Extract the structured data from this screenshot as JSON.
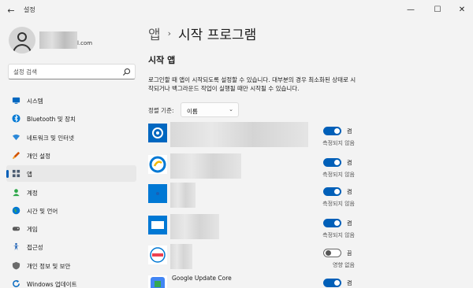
{
  "window": {
    "title": "설정",
    "back_glyph": "←",
    "minimize_glyph": "—",
    "maximize_glyph": "☐",
    "close_glyph": "✕"
  },
  "user": {
    "email_suffix": "l.com"
  },
  "search": {
    "placeholder": "설정 검색"
  },
  "nav": {
    "items": [
      {
        "label": "시스템",
        "icon": "monitor-icon",
        "color": "#0067c0"
      },
      {
        "label": "Bluetooth 및 장치",
        "icon": "bluetooth-icon",
        "color": "#0078d4"
      },
      {
        "label": "네트워크 및 인터넷",
        "icon": "network-icon",
        "color": "#2b88d8"
      },
      {
        "label": "개인 설정",
        "icon": "brush-icon",
        "color": "#d35400"
      },
      {
        "label": "앱",
        "icon": "apps-icon",
        "color": "#4a5a70",
        "active": true
      },
      {
        "label": "계정",
        "icon": "account-icon",
        "color": "#2ea84a"
      },
      {
        "label": "시간 및 언어",
        "icon": "globe-icon",
        "color": "#0078d4"
      },
      {
        "label": "게임",
        "icon": "game-icon",
        "color": "#5a5a5a"
      },
      {
        "label": "접근성",
        "icon": "accessibility-icon",
        "color": "#1a5fb4"
      },
      {
        "label": "개인 정보 및 보안",
        "icon": "shield-icon",
        "color": "#6b6b6b"
      },
      {
        "label": "Windows 업데이트",
        "icon": "update-icon",
        "color": "#0067c0"
      }
    ]
  },
  "breadcrumb": {
    "parent": "앱",
    "separator": "›",
    "current": "시작 프로그램"
  },
  "section": {
    "title": "시작 앱",
    "description": "로그인할 때 앱이 시작되도록 설정할 수 있습니다. 대부분의 경우 최소화된 상태로 시작되거나 백그라운드 작업이 실행될 때만 시작될 수 있습니다."
  },
  "sort": {
    "label": "정렬 기준:",
    "value": "이름",
    "chevron": "⌄"
  },
  "apps": [
    {
      "name": "",
      "icon": "gear-app-icon",
      "state": "켬",
      "on": true,
      "impact": "측정되지 않음"
    },
    {
      "name": "",
      "icon": "circle-app-icon",
      "state": "켬",
      "on": true,
      "impact": "측정되지 않음"
    },
    {
      "name": "",
      "icon": "blue-app-icon",
      "state": "켬",
      "on": true,
      "impact": "측정되지 않음"
    },
    {
      "name": "",
      "icon": "window-app-icon",
      "state": "켬",
      "on": true,
      "impact": "측정되지 않음"
    },
    {
      "name": "",
      "icon": "red-text-app-icon",
      "state": "끔",
      "on": false,
      "impact": "영향 없음"
    },
    {
      "name": "Google Update Core",
      "icon": "google-update-icon",
      "state": "켬",
      "on": true,
      "impact": ""
    }
  ],
  "colors": {
    "accent": "#005fb8",
    "background": "#f3f3f3"
  }
}
